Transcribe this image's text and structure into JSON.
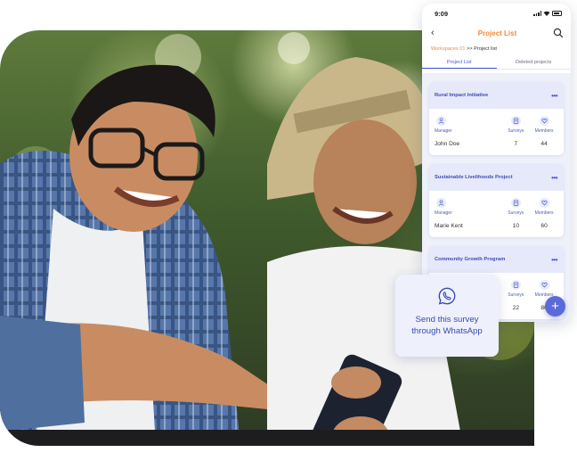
{
  "phone": {
    "status_time": "9:09",
    "title": "Project List",
    "breadcrumb": {
      "root": "Workspaces 01",
      "separator": ">>",
      "current": "Project list"
    },
    "tabs": [
      {
        "label": "Project List",
        "active": true
      },
      {
        "label": "Deleted projects",
        "active": false
      }
    ],
    "column_labels": {
      "manager": "Manager",
      "surveys": "Surveys",
      "members": "Members"
    },
    "projects": [
      {
        "name": "Rural Impact Initiative",
        "manager": "John Doe",
        "surveys": "7",
        "members": "44"
      },
      {
        "name": "Sustainable Livelihoods Project",
        "manager": "Marie Kent",
        "surveys": "10",
        "members": "60"
      },
      {
        "name": "Community Growth Program",
        "manager": "",
        "surveys": "22",
        "members": "80"
      }
    ],
    "fab_label": "+",
    "menu_glyph": "•••"
  },
  "whatsapp_card": {
    "text": "Send this survey through WhatsApp"
  },
  "colors": {
    "accent_orange": "#f08a3c",
    "accent_blue": "#4a5bd0",
    "fab_blue": "#5a6bd8"
  },
  "icons": [
    "back-icon",
    "search-icon",
    "user-icon",
    "document-icon",
    "heart-icon",
    "plus-icon",
    "whatsapp-icon"
  ]
}
